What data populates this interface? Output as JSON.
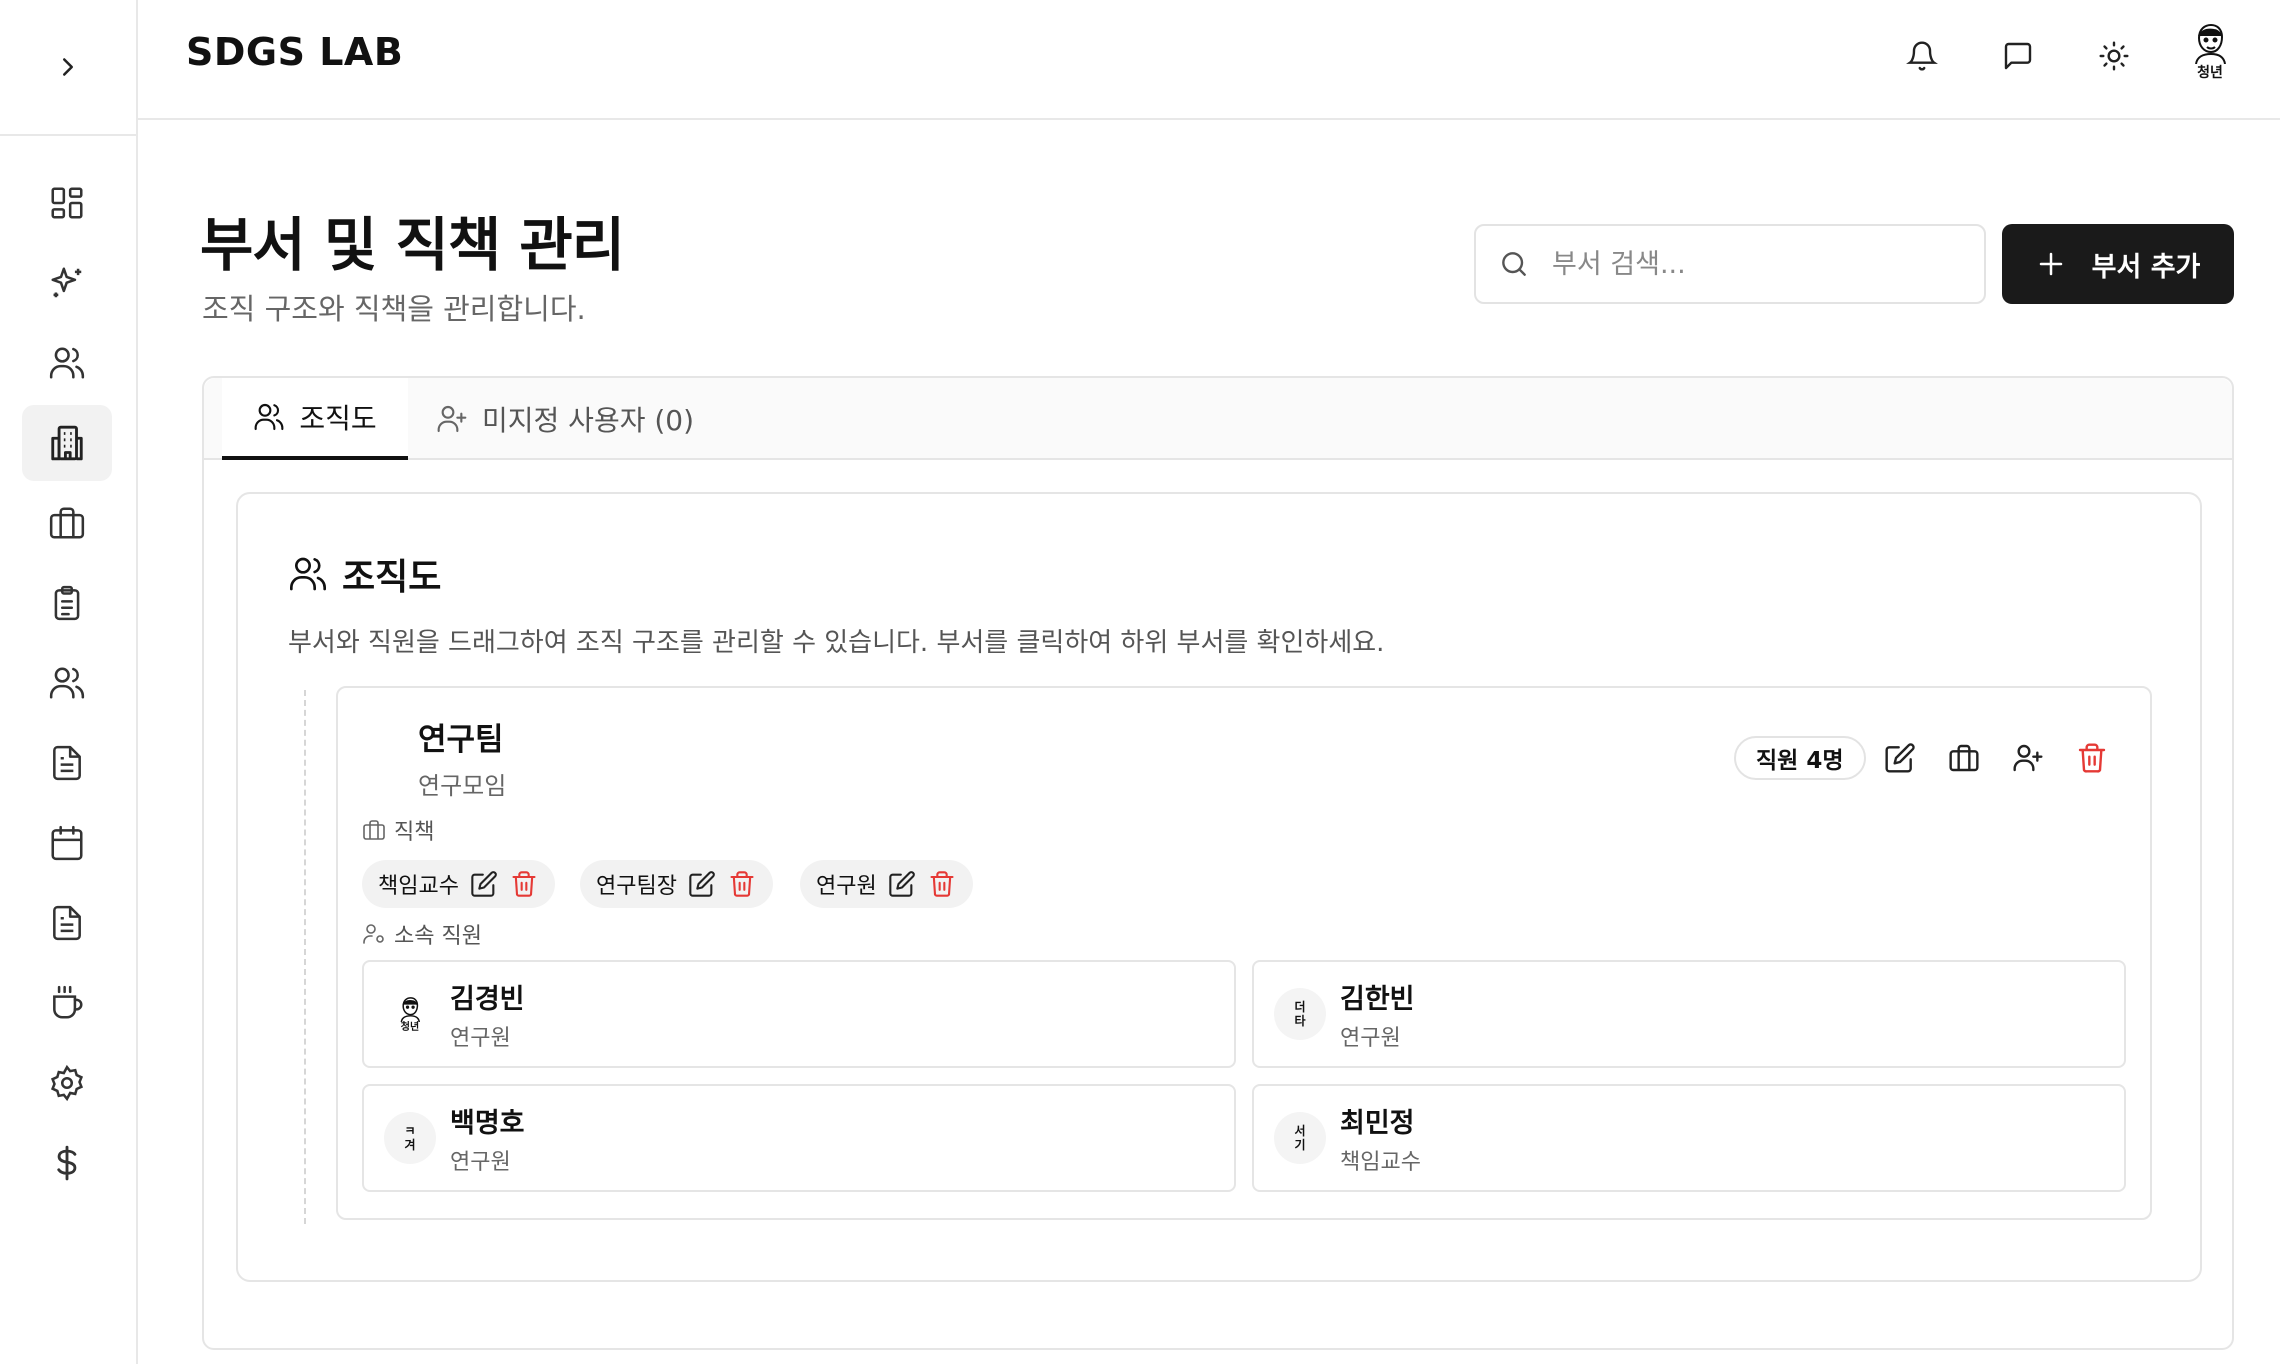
{
  "app": {
    "brand": "SDGS LAB"
  },
  "topbar": {
    "icons": [
      "bell-icon",
      "message-icon",
      "sun-icon"
    ],
    "user_label": "청년"
  },
  "sidebar": {
    "items": [
      {
        "icon": "dashboard-icon",
        "active": false
      },
      {
        "icon": "sparkles-icon",
        "active": false
      },
      {
        "icon": "users-icon",
        "active": false
      },
      {
        "icon": "building-icon",
        "active": true
      },
      {
        "icon": "briefcase-icon",
        "active": false
      },
      {
        "icon": "clipboard-list-icon",
        "active": false
      },
      {
        "icon": "users-icon",
        "active": false
      },
      {
        "icon": "file-text-icon",
        "active": false
      },
      {
        "icon": "calendar-icon",
        "active": false
      },
      {
        "icon": "file-text-icon",
        "active": false
      },
      {
        "icon": "coffee-icon",
        "active": false
      },
      {
        "icon": "settings-icon",
        "active": false
      },
      {
        "icon": "dollar-icon",
        "active": false
      }
    ]
  },
  "page": {
    "title": "부서 및 직책 관리",
    "subtitle": "조직 구조와 직책을 관리합니다.",
    "search_placeholder": "부서 검색...",
    "add_button": "부서 추가"
  },
  "tabs": [
    {
      "label": "조직도",
      "active": true
    },
    {
      "label": "미지정 사용자 (0)",
      "active": false
    }
  ],
  "org": {
    "title": "조직도",
    "description": "부서와 직원을 드래그하여 조직 구조를 관리할 수 있습니다. 부서를 클릭하여 하위 부서를 확인하세요.",
    "department": {
      "name": "연구팀",
      "description": "연구모임",
      "member_badge": "직원 4명",
      "positions_label": "직책",
      "positions": [
        "책임교수",
        "연구팀장",
        "연구원"
      ],
      "members_label": "소속 직원",
      "members": [
        {
          "name": "김경빈",
          "role": "연구원",
          "avatar_text": "청년"
        },
        {
          "name": "김한빈",
          "role": "연구원",
          "avatar_text": "더\n타"
        },
        {
          "name": "백명호",
          "role": "연구원",
          "avatar_text": "ㅋ\n겨"
        },
        {
          "name": "최민정",
          "role": "책임교수",
          "avatar_text": "서\n기"
        }
      ]
    }
  },
  "colors": {
    "primary": "#1a1a1a",
    "danger": "#e53935",
    "border": "#e5e5e5"
  }
}
